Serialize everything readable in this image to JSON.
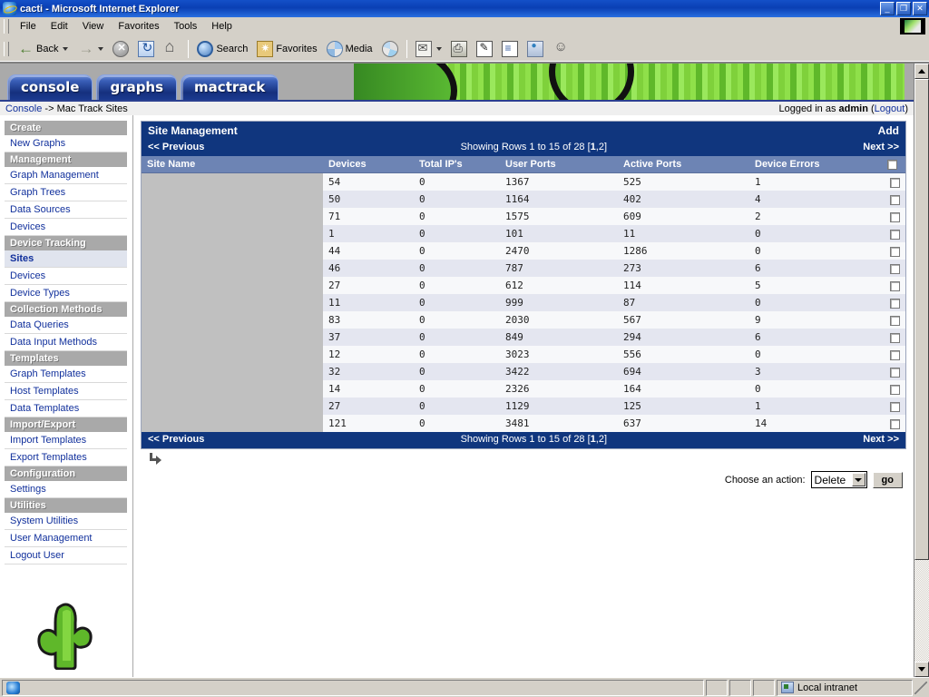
{
  "window": {
    "title": "cacti - Microsoft Internet Explorer",
    "minimize": "_",
    "maximize": "❐",
    "close": "✕"
  },
  "menu": {
    "items": [
      {
        "label": "File"
      },
      {
        "label": "Edit"
      },
      {
        "label": "View"
      },
      {
        "label": "Favorites"
      },
      {
        "label": "Tools"
      },
      {
        "label": "Help"
      }
    ]
  },
  "toolbar": {
    "back_label": "Back",
    "forward_label": "",
    "search_label": "Search",
    "favorites_label": "Favorites",
    "media_label": "Media"
  },
  "cacti": {
    "tabs": [
      {
        "label": "console",
        "name": "tab-console"
      },
      {
        "label": "graphs",
        "name": "tab-graphs"
      },
      {
        "label": "mactrack",
        "name": "tab-mactrack"
      }
    ],
    "breadcrumb_root": "Console",
    "breadcrumb_sep": " -> ",
    "breadcrumb_current": "Mac Track Sites",
    "logged_in_prefix": "Logged in as ",
    "logged_in_user": "admin",
    "logout_open": " (",
    "logout_label": "Logout",
    "logout_close": ")"
  },
  "sidebar": {
    "groups": [
      {
        "header": "Create",
        "items": [
          {
            "label": "New Graphs",
            "selected": false
          }
        ]
      },
      {
        "header": "Management",
        "items": [
          {
            "label": "Graph Management",
            "selected": false
          },
          {
            "label": "Graph Trees",
            "selected": false
          },
          {
            "label": "Data Sources",
            "selected": false
          },
          {
            "label": "Devices",
            "selected": false
          }
        ]
      },
      {
        "header": "Device Tracking",
        "items": [
          {
            "label": "Sites",
            "selected": true
          },
          {
            "label": "Devices",
            "selected": false
          },
          {
            "label": "Device Types",
            "selected": false
          }
        ]
      },
      {
        "header": "Collection Methods",
        "items": [
          {
            "label": "Data Queries",
            "selected": false
          },
          {
            "label": "Data Input Methods",
            "selected": false
          }
        ]
      },
      {
        "header": "Templates",
        "items": [
          {
            "label": "Graph Templates",
            "selected": false
          },
          {
            "label": "Host Templates",
            "selected": false
          },
          {
            "label": "Data Templates",
            "selected": false
          }
        ]
      },
      {
        "header": "Import/Export",
        "items": [
          {
            "label": "Import Templates",
            "selected": false
          },
          {
            "label": "Export Templates",
            "selected": false
          }
        ]
      },
      {
        "header": "Configuration",
        "items": [
          {
            "label": "Settings",
            "selected": false
          }
        ]
      },
      {
        "header": "Utilities",
        "items": [
          {
            "label": "System Utilities",
            "selected": false
          },
          {
            "label": "User Management",
            "selected": false
          },
          {
            "label": "Logout User",
            "selected": false
          }
        ]
      }
    ]
  },
  "main": {
    "panel_title": "Site Management",
    "add_label": "Add",
    "previous_label": "<< Previous",
    "next_label": "Next >>",
    "showing_prefix": "Showing Rows 1 to 15 of 28 [",
    "page_current": "1",
    "page_sep": ",",
    "page_other": "2",
    "showing_suffix": "]",
    "columns": [
      "Site Name",
      "Devices",
      "Total IP's",
      "User Ports",
      "Active Ports",
      "Device Errors"
    ],
    "rows": [
      {
        "site_name": "",
        "devices": "54",
        "total_ips": "0",
        "user_ports": "1367",
        "active_ports": "525",
        "device_errors": "1"
      },
      {
        "site_name": "",
        "devices": "50",
        "total_ips": "0",
        "user_ports": "1164",
        "active_ports": "402",
        "device_errors": "4"
      },
      {
        "site_name": "",
        "devices": "71",
        "total_ips": "0",
        "user_ports": "1575",
        "active_ports": "609",
        "device_errors": "2"
      },
      {
        "site_name": "",
        "devices": "1",
        "total_ips": "0",
        "user_ports": "101",
        "active_ports": "11",
        "device_errors": "0"
      },
      {
        "site_name": "",
        "devices": "44",
        "total_ips": "0",
        "user_ports": "2470",
        "active_ports": "1286",
        "device_errors": "0"
      },
      {
        "site_name": "",
        "devices": "46",
        "total_ips": "0",
        "user_ports": "787",
        "active_ports": "273",
        "device_errors": "6"
      },
      {
        "site_name": "",
        "devices": "27",
        "total_ips": "0",
        "user_ports": "612",
        "active_ports": "114",
        "device_errors": "5"
      },
      {
        "site_name": "",
        "devices": "11",
        "total_ips": "0",
        "user_ports": "999",
        "active_ports": "87",
        "device_errors": "0"
      },
      {
        "site_name": "",
        "devices": "83",
        "total_ips": "0",
        "user_ports": "2030",
        "active_ports": "567",
        "device_errors": "9"
      },
      {
        "site_name": "",
        "devices": "37",
        "total_ips": "0",
        "user_ports": "849",
        "active_ports": "294",
        "device_errors": "6"
      },
      {
        "site_name": "",
        "devices": "12",
        "total_ips": "0",
        "user_ports": "3023",
        "active_ports": "556",
        "device_errors": "0"
      },
      {
        "site_name": "",
        "devices": "32",
        "total_ips": "0",
        "user_ports": "3422",
        "active_ports": "694",
        "device_errors": "3"
      },
      {
        "site_name": "",
        "devices": "14",
        "total_ips": "0",
        "user_ports": "2326",
        "active_ports": "164",
        "device_errors": "0"
      },
      {
        "site_name": "",
        "devices": "27",
        "total_ips": "0",
        "user_ports": "1129",
        "active_ports": "125",
        "device_errors": "1"
      },
      {
        "site_name": "",
        "devices": "121",
        "total_ips": "0",
        "user_ports": "3481",
        "active_ports": "637",
        "device_errors": "14"
      }
    ],
    "action_label": "Choose an action:",
    "action_selected": "Delete",
    "action_options": [
      "Delete"
    ],
    "go_label": "go"
  },
  "statusbar": {
    "message": "",
    "zone": "Local intranet"
  },
  "colors": {
    "header_blue": "#10367e",
    "table_header": "#6d84b4",
    "nav_header_gray": "#a9a9a9",
    "link_blue": "#11309c",
    "row_odd": "#f7f8fa",
    "row_even": "#e4e6f0",
    "masked_gray": "#c0c0c0",
    "cactus_green": "#5fb82a",
    "titlebar_blue": "#0a3fb4"
  }
}
